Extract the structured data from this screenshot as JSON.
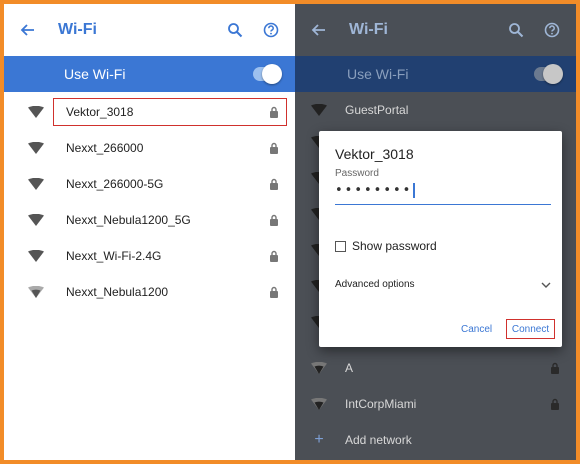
{
  "colors": {
    "accent": "#3b77d4",
    "highlight": "#d0312d",
    "frame": "#f28c28"
  },
  "left": {
    "title": "Wi-Fi",
    "use_wifi_label": "Use Wi-Fi",
    "networks": [
      {
        "name": "Vektor_3018",
        "icon": "wifi-icon",
        "secured": true,
        "selected": true
      },
      {
        "name": "Nexxt_266000",
        "icon": "wifi-icon",
        "secured": true
      },
      {
        "name": "Nexxt_266000-5G",
        "icon": "wifi-icon",
        "secured": true
      },
      {
        "name": "Nexxt_Nebula1200_5G",
        "icon": "wifi-icon",
        "secured": true
      },
      {
        "name": "Nexxt_Wi-Fi-2.4G",
        "icon": "wifi-icon",
        "secured": true
      },
      {
        "name": "Nexxt_Nebula1200",
        "icon": "wifi-icon",
        "secured": true
      }
    ]
  },
  "right": {
    "title": "Wi-Fi",
    "use_wifi_label": "Use Wi-Fi",
    "networks_above": [
      {
        "name": "GuestPortal"
      }
    ],
    "networks_below": [
      {
        "name": "A",
        "secured": true
      },
      {
        "name": "IntCorpMiami",
        "secured": true
      }
    ],
    "add_network_label": "Add network",
    "dialog": {
      "title": "Vektor_3018",
      "password_label": "Password",
      "password_value": "••••••••",
      "show_password_label": "Show password",
      "advanced_label": "Advanced options",
      "cancel_label": "Cancel",
      "connect_label": "Connect"
    }
  }
}
